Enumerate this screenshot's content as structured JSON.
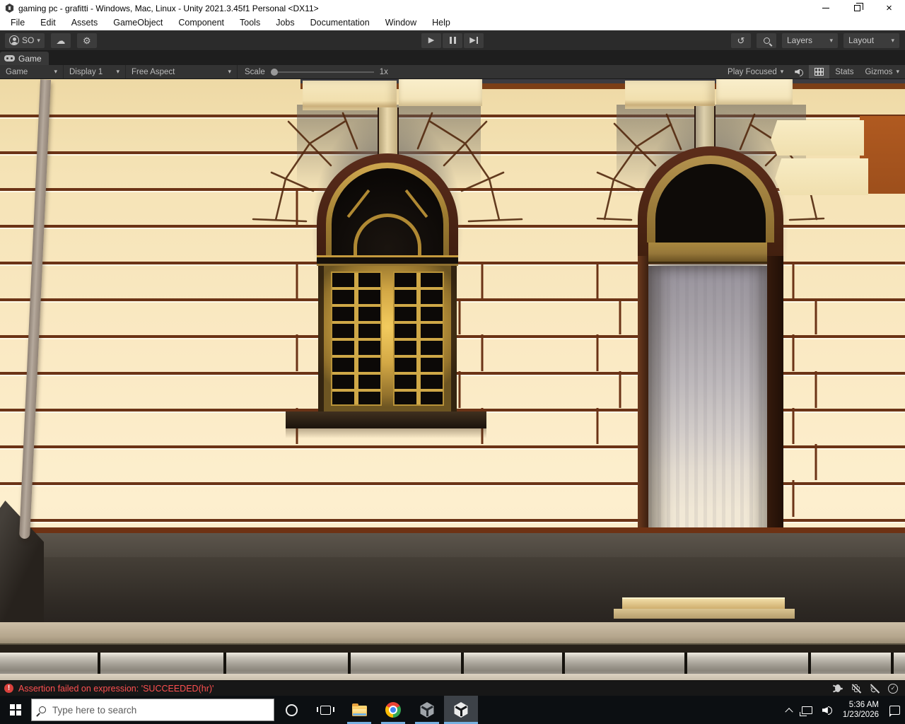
{
  "window": {
    "title": "gaming pc - grafitti - Windows, Mac, Linux - Unity 2021.3.45f1 Personal <DX11>"
  },
  "menu": {
    "items": [
      "File",
      "Edit",
      "Assets",
      "GameObject",
      "Component",
      "Tools",
      "Jobs",
      "Documentation",
      "Window",
      "Help"
    ]
  },
  "toolbar": {
    "account_label": "SO",
    "layers_label": "Layers",
    "layout_label": "Layout"
  },
  "tabs": {
    "game_label": "Game"
  },
  "gameview": {
    "view_dropdown": "Game",
    "display_dropdown": "Display 1",
    "aspect_dropdown": "Free Aspect",
    "scale_label": "Scale",
    "scale_value": "1x",
    "play_focused": "Play Focused",
    "stats_label": "Stats",
    "gizmos_label": "Gizmos"
  },
  "statusbar": {
    "message": "Assertion failed on expression: 'SUCCEEDED(hr)'"
  },
  "taskbar": {
    "search_placeholder": "Type here to search",
    "time": "5:36 AM",
    "date": "1/23/2026"
  },
  "glyphs": {
    "caret": "▾",
    "cloud": "☁",
    "gear": "⚙",
    "history": "↺",
    "play": "▶",
    "refresh": "↻",
    "check": "✓",
    "close": "×",
    "exclaim": "!"
  },
  "scene": {
    "colors": {
      "wall": "#f8e8c2",
      "mortar_line": "#6b3316",
      "arch_brown": "#4e2517",
      "frame_gold": "#cfa847",
      "glass": "#0c0907",
      "door_transom": "#9a7c3a",
      "curtain_top": "#9d98a2",
      "curtain_bottom": "#f5edda",
      "plinth": "#3a342e",
      "ledge": "#bdae95",
      "curb": "#a5a096",
      "road": "#d5cbba",
      "accent_orange": "#a8541d",
      "pole": "#a89a8c",
      "block_shadow": "#8a867f"
    }
  }
}
